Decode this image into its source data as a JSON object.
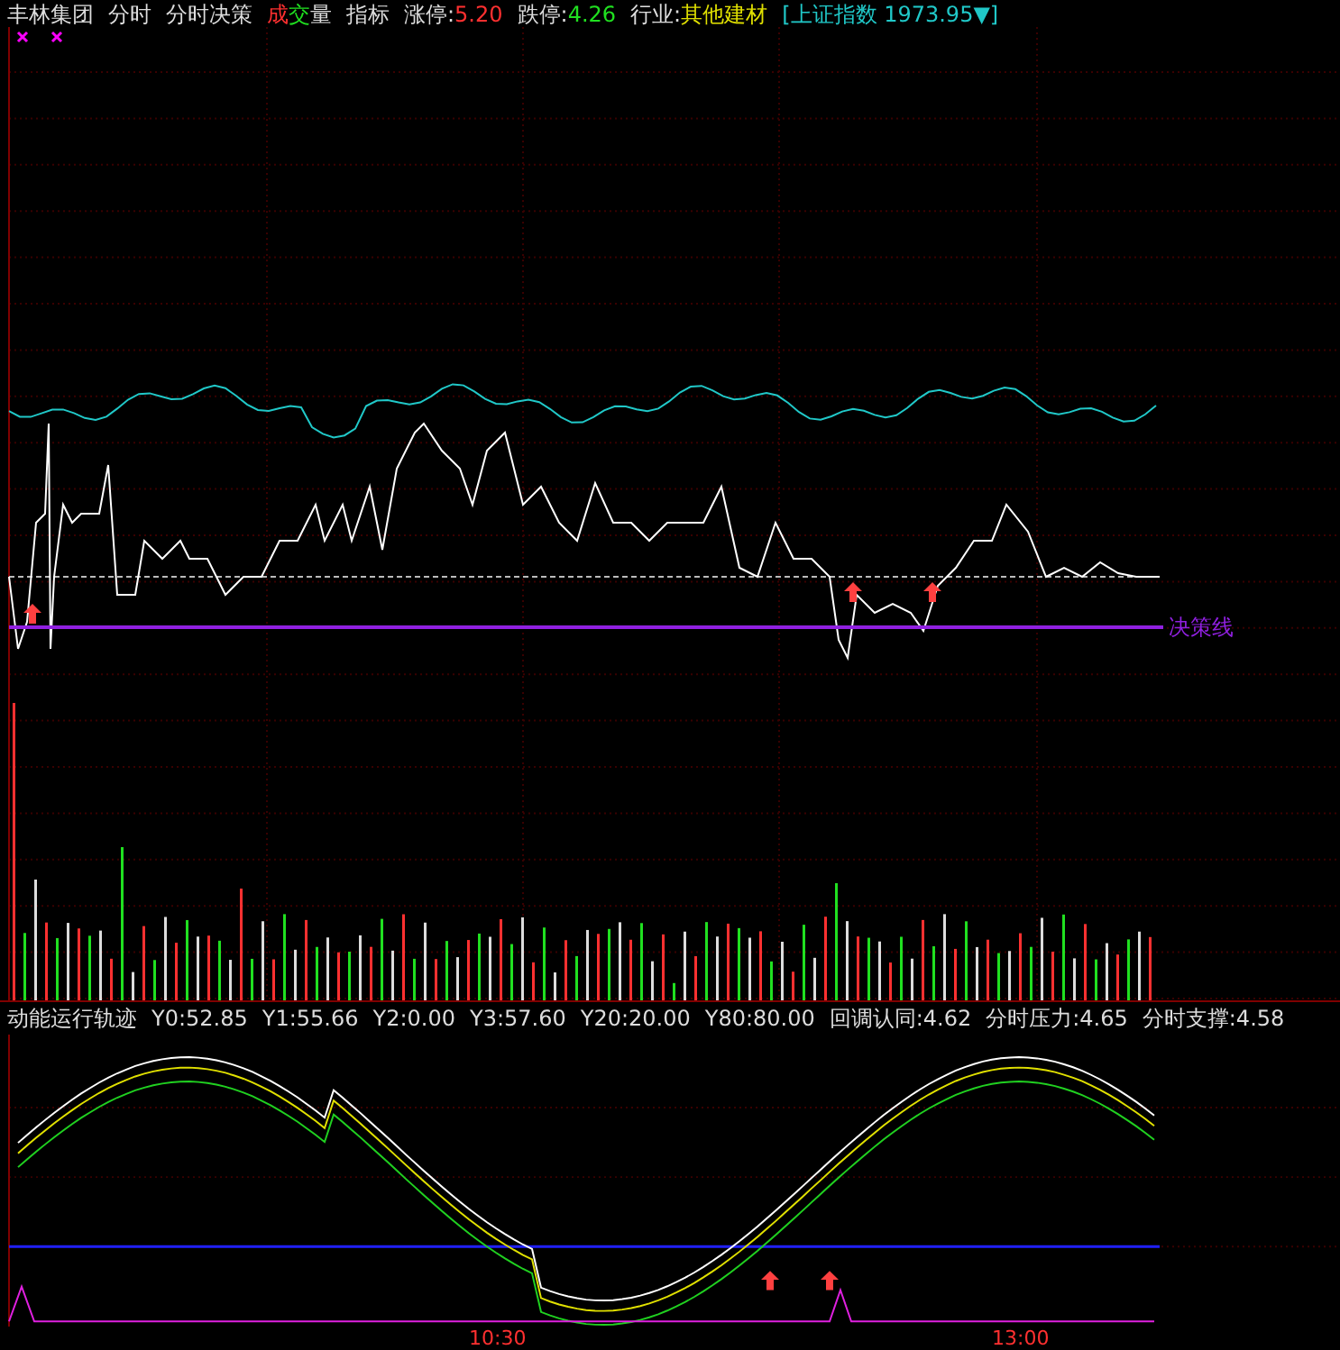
{
  "header": {
    "stock_name": "丰林集团",
    "tabs": [
      "分时",
      "分时决策",
      "成交量",
      "指标"
    ],
    "quotes": [
      {
        "kind": "up",
        "label": "涨停:",
        "value": "5.20"
      },
      {
        "kind": "down",
        "label": "跌停:",
        "value": "4.26"
      },
      {
        "kind": "industry",
        "label": "行业:",
        "value": "其他建材"
      }
    ],
    "index": "[上证指数 1973.95▼]"
  },
  "main_chart": {
    "decision_line_label": "决策线"
  },
  "indicator": {
    "title": "动能运行轨迹",
    "readings": [
      "Y0:52.85",
      "Y1:55.66",
      "Y2:0.00",
      "Y3:57.60",
      "Y20:20.00",
      "Y80:80.00",
      "回调认同:4.62",
      "分时压力:4.65",
      "分时支撑:4.58"
    ]
  },
  "time_axis": [
    "10:30",
    "13:00"
  ]
}
